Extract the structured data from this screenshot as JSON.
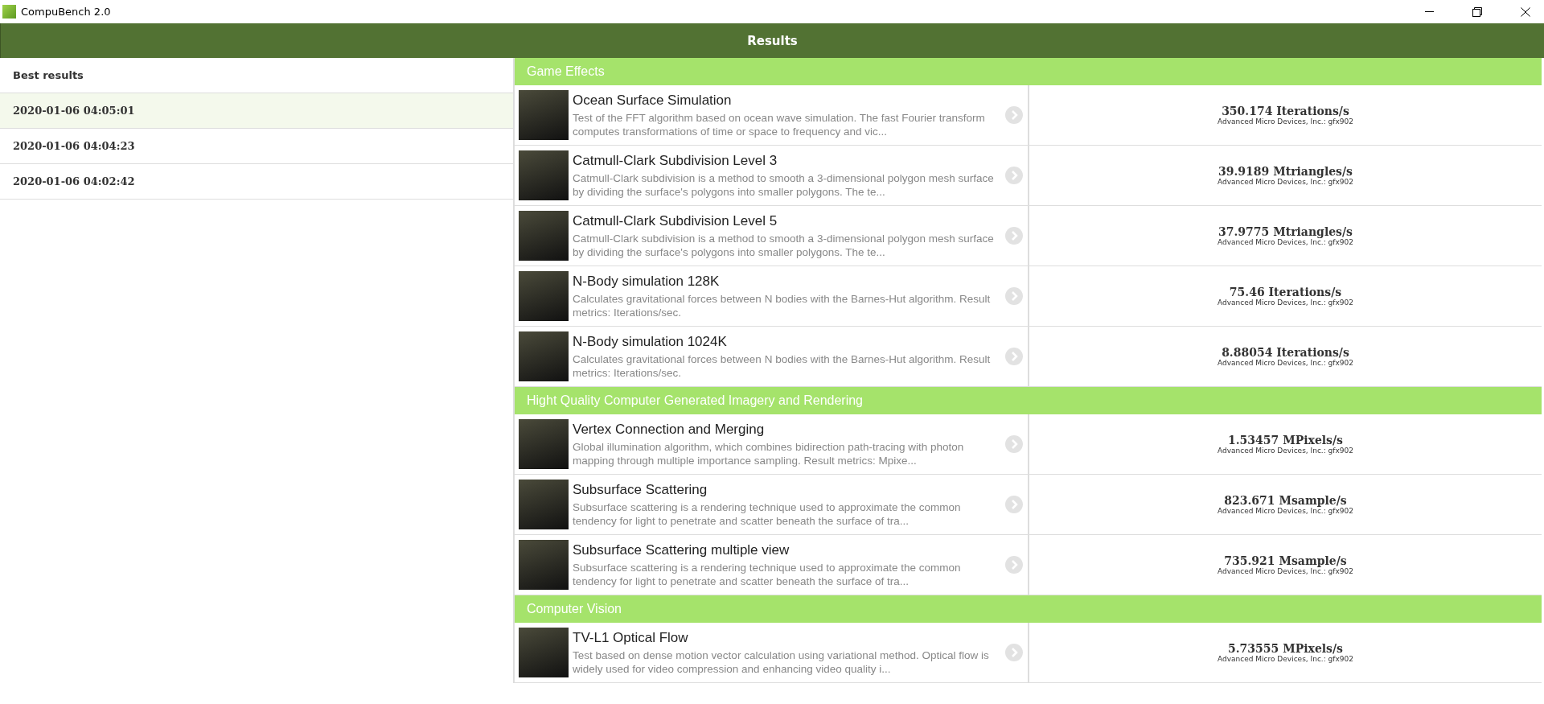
{
  "window": {
    "title": "CompuBench 2.0"
  },
  "header": {
    "title": "Results"
  },
  "best_results": {
    "title": "Best results",
    "items": [
      {
        "label": "2020-01-06 04:05:01",
        "selected": true
      },
      {
        "label": "2020-01-06 04:04:23",
        "selected": false
      },
      {
        "label": "2020-01-06 04:02:42",
        "selected": false
      }
    ]
  },
  "sections": [
    {
      "title": "Game Effects",
      "tests": [
        {
          "name": "Ocean Surface Simulation",
          "description": "Test of the FFT algorithm based on ocean wave simulation. The fast Fourier transform computes transformations of time or space to frequency and vic...",
          "score": "350.174 Iterations/s",
          "device": "Advanced Micro Devices, Inc.: gfx902"
        },
        {
          "name": "Catmull-Clark Subdivision Level 3",
          "description": "Catmull-Clark subdivision is a method to smooth a 3-dimensional polygon mesh surface by dividing the surface's polygons into smaller polygons. The te...",
          "score": "39.9189 Mtriangles/s",
          "device": "Advanced Micro Devices, Inc.: gfx902"
        },
        {
          "name": "Catmull-Clark Subdivision Level 5",
          "description": "Catmull-Clark subdivision is a method to smooth a 3-dimensional polygon mesh surface by dividing the surface's polygons into smaller polygons. The te...",
          "score": "37.9775 Mtriangles/s",
          "device": "Advanced Micro Devices, Inc.: gfx902"
        },
        {
          "name": "N-Body simulation 128K",
          "description": "Calculates gravitational forces between N bodies with the Barnes-Hut algorithm. Result metrics: Iterations/sec.",
          "score": "75.46 Iterations/s",
          "device": "Advanced Micro Devices, Inc.: gfx902"
        },
        {
          "name": "N-Body simulation 1024K",
          "description": "Calculates gravitational forces between N bodies with the Barnes-Hut algorithm. Result metrics: Iterations/sec.",
          "score": "8.88054 Iterations/s",
          "device": "Advanced Micro Devices, Inc.: gfx902"
        }
      ]
    },
    {
      "title": "Hight Quality Computer Generated Imagery and Rendering",
      "tests": [
        {
          "name": "Vertex Connection and Merging",
          "description": "Global illumination algorithm, which combines bidirection path-tracing with photon mapping through multiple importance sampling. Result metrics: Mpixe...",
          "score": "1.53457 MPixels/s",
          "device": "Advanced Micro Devices, Inc.: gfx902"
        },
        {
          "name": "Subsurface Scattering",
          "description": "Subsurface scattering is a rendering technique used to approximate the common tendency for light to penetrate and scatter beneath the surface of tra...",
          "score": "823.671 Msample/s",
          "device": "Advanced Micro Devices, Inc.: gfx902"
        },
        {
          "name": "Subsurface Scattering multiple view",
          "description": "Subsurface scattering is a rendering technique used to approximate the common tendency for light to penetrate and scatter beneath the surface of tra...",
          "score": "735.921 Msample/s",
          "device": "Advanced Micro Devices, Inc.: gfx902"
        }
      ]
    },
    {
      "title": "Computer Vision",
      "tests": [
        {
          "name": "TV-L1 Optical Flow",
          "description": "Test based on dense motion vector calculation using variational method. Optical flow is widely used for video compression and enhancing video quality i...",
          "score": "5.73555 MPixels/s",
          "device": "Advanced Micro Devices, Inc.: gfx902"
        }
      ]
    }
  ]
}
